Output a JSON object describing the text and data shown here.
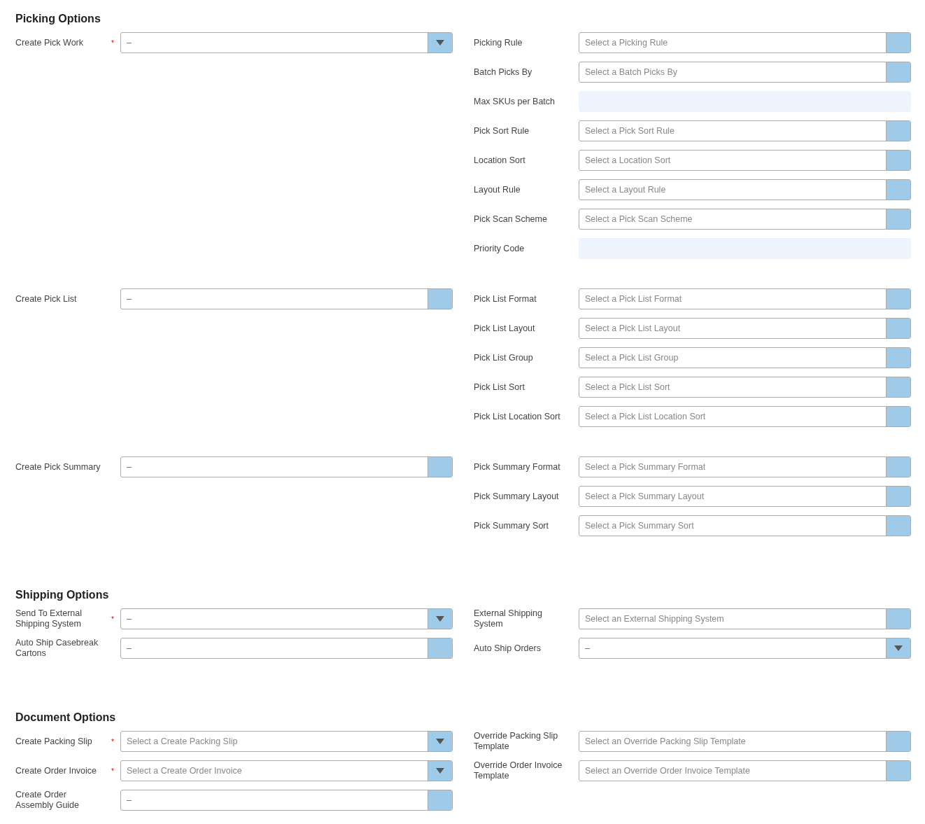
{
  "sections": [
    {
      "title": "Picking Options",
      "groups": [
        {
          "left": [
            {
              "label": "Create Pick Work",
              "required_mark": "*",
              "kind": "select",
              "value": "–",
              "disabled": false
            }
          ],
          "right": [
            {
              "label": "Picking Rule",
              "kind": "select",
              "placeholder": "Select a Picking Rule",
              "disabled": true
            },
            {
              "label": "Batch Picks By",
              "kind": "select",
              "placeholder": "Select a Batch Picks By",
              "disabled": true
            },
            {
              "label": "Max SKUs per Batch",
              "kind": "text",
              "disabled": true
            },
            {
              "label": "Pick Sort Rule",
              "kind": "select",
              "placeholder": "Select a Pick Sort Rule",
              "disabled": true
            },
            {
              "label": "Location Sort",
              "kind": "select",
              "placeholder": "Select a Location Sort",
              "disabled": true
            },
            {
              "label": "Layout Rule",
              "kind": "select",
              "placeholder": "Select a Layout Rule",
              "disabled": true
            },
            {
              "label": "Pick Scan Scheme",
              "kind": "select",
              "placeholder": "Select a Pick Scan Scheme",
              "disabled": true
            },
            {
              "label": "Priority Code",
              "kind": "text",
              "disabled": true
            }
          ]
        },
        {
          "left": [
            {
              "label": "Create Pick List",
              "kind": "select",
              "value": "–",
              "disabled": true
            }
          ],
          "right": [
            {
              "label": "Pick List Format",
              "kind": "select",
              "placeholder": "Select a Pick List Format",
              "disabled": true
            },
            {
              "label": "Pick List Layout",
              "kind": "select",
              "placeholder": "Select a Pick List Layout",
              "disabled": true
            },
            {
              "label": "Pick List Group",
              "kind": "select",
              "placeholder": "Select a Pick List Group",
              "disabled": true
            },
            {
              "label": "Pick List Sort",
              "kind": "select",
              "placeholder": "Select a Pick List Sort",
              "disabled": true
            },
            {
              "label": "Pick List Location Sort",
              "kind": "select",
              "placeholder": "Select a Pick List Location Sort",
              "disabled": true
            }
          ]
        },
        {
          "left": [
            {
              "label": "Create Pick Summary",
              "kind": "select",
              "value": "–",
              "disabled": true
            }
          ],
          "right": [
            {
              "label": "Pick Summary Format",
              "kind": "select",
              "placeholder": "Select a Pick Summary Format",
              "disabled": true
            },
            {
              "label": "Pick Summary Layout",
              "kind": "select",
              "placeholder": "Select a Pick Summary Layout",
              "disabled": true
            },
            {
              "label": "Pick Summary Sort",
              "kind": "select",
              "placeholder": "Select a Pick Summary Sort",
              "disabled": true
            }
          ]
        }
      ]
    },
    {
      "title": "Shipping Options",
      "groups": [
        {
          "left": [
            {
              "label": "Send To External Shipping System",
              "required_mark": "*",
              "kind": "select",
              "value": "–",
              "disabled": false
            },
            {
              "label": "Auto Ship Casebreak Cartons",
              "kind": "select",
              "value": "–",
              "disabled": true
            }
          ],
          "right": [
            {
              "label": "External Shipping System",
              "kind": "select",
              "placeholder": "Select an External Shipping System",
              "disabled": true
            },
            {
              "label": "Auto Ship Orders",
              "kind": "select",
              "value": "–",
              "disabled": false
            }
          ]
        }
      ]
    },
    {
      "title": "Document Options",
      "groups": [
        {
          "left": [
            {
              "label": "Create Packing Slip",
              "required_mark": "*",
              "kind": "select",
              "placeholder": "Select a Create Packing Slip",
              "disabled": false
            },
            {
              "label": "Create Order Invoice",
              "required_mark": "*",
              "kind": "select",
              "placeholder": "Select a Create Order Invoice",
              "disabled": false
            },
            {
              "label": "Create Order Assembly Guide",
              "kind": "select",
              "value": "–",
              "disabled": true
            }
          ],
          "right": [
            {
              "label": "Override Packing Slip Template",
              "kind": "select",
              "placeholder": "Select an Override Packing Slip Template",
              "disabled": true
            },
            {
              "label": "Override Order Invoice Template",
              "kind": "select",
              "placeholder": "Select an Override Order Invoice Template",
              "disabled": true
            }
          ]
        }
      ]
    }
  ]
}
